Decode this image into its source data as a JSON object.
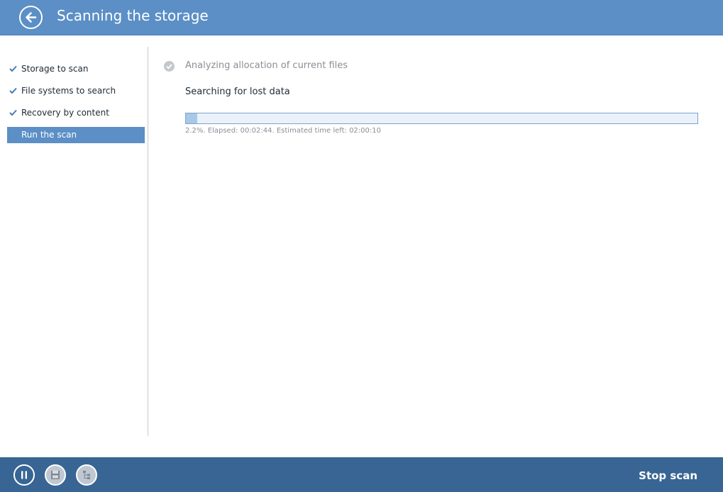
{
  "header": {
    "title": "Scanning the storage",
    "back_icon": "back-arrow-icon"
  },
  "sidebar": {
    "steps": [
      {
        "label": "Storage to scan",
        "completed": true,
        "active": false
      },
      {
        "label": "File systems to search",
        "completed": true,
        "active": false
      },
      {
        "label": "Recovery by content",
        "completed": true,
        "active": false
      },
      {
        "label": "Run the scan",
        "completed": false,
        "active": true
      }
    ]
  },
  "main": {
    "completed_phase": "Analyzing allocation of current files",
    "current_phase": "Searching for lost data",
    "progress_percent": 2.2,
    "progress_text": "2.2%. Elapsed: 00:02:44. Estimated time left: 02:00:10"
  },
  "footer": {
    "buttons": [
      {
        "icon": "pause-icon"
      },
      {
        "icon": "save-icon"
      },
      {
        "icon": "tree-icon"
      }
    ],
    "stop_label": "Stop scan"
  },
  "colors": {
    "header": "#5b8fc6",
    "footer": "#386593",
    "active_step": "#5b8fc6",
    "progress_fill": "#a9c8e8"
  }
}
